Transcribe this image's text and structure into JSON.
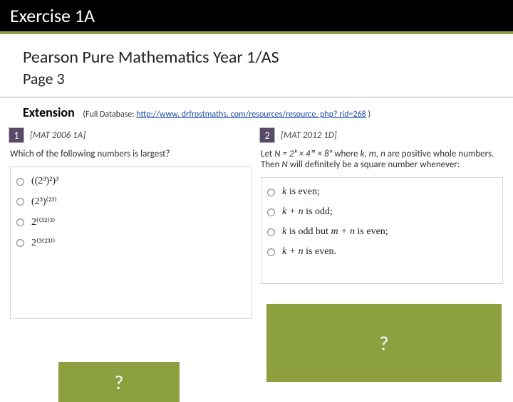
{
  "title": "Exercise 1A",
  "subheading": {
    "line1": "Pearson Pure Mathematics Year 1/AS",
    "line2": "Page 3"
  },
  "extension": {
    "label": "Extension",
    "note_prefix": "(Full Database: ",
    "url": "http://www. drfrostmaths. com/resources/resource. php? rid=268",
    "note_suffix": " )"
  },
  "q1": {
    "num": "1",
    "source": "[MAT 2006 1A]",
    "prompt": "Which of the following numbers is largest?",
    "opts": {
      "a": "((2³)²)³",
      "b": "(2³)⁽²³⁾",
      "c": "2⁽⁽³²⁾³⁾",
      "d": "2⁽³⁽²³⁾⁾"
    },
    "answer_mark": "?"
  },
  "q2": {
    "num": "2",
    "source": "[MAT 2012 1D]",
    "prompt_prefix": "Let ",
    "prompt_eq": "N = 2ᵏ × 4ᵐ × 8ⁿ",
    "prompt_mid": " where ",
    "prompt_vars": "k, m, n",
    "prompt_suffix": " are positive whole numbers.",
    "prompt2_prefix": "Then ",
    "prompt2_var": "N",
    "prompt2_suffix": " will definitely be a square number whenever:",
    "opts": {
      "a_pre": "k",
      "a_post": " is even;",
      "b_pre": "k + n",
      "b_post": " is odd;",
      "c_pre": "k",
      "c_mid": " is odd but ",
      "c_var2": "m + n",
      "c_post": " is even;",
      "d_pre": "k + n",
      "d_post": " is even."
    },
    "answer_mark": "?"
  }
}
